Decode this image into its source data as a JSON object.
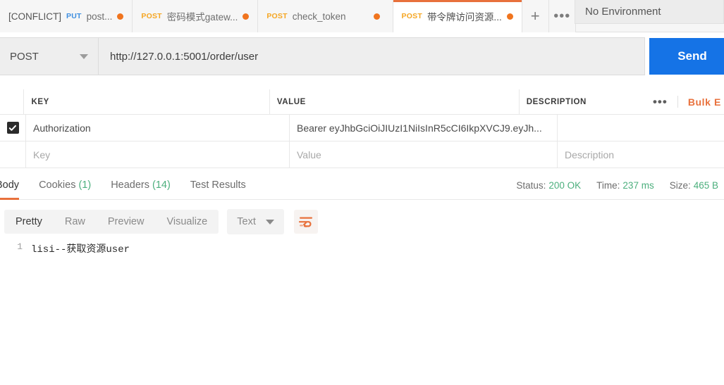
{
  "tabs": [
    {
      "prefix": "[CONFLICT]",
      "method": "PUT",
      "method_class": "put",
      "name": "post...",
      "unsaved": true,
      "active": false
    },
    {
      "prefix": "",
      "method": "POST",
      "method_class": "post",
      "name": "密码模式gatew...",
      "unsaved": true,
      "active": false
    },
    {
      "prefix": "",
      "method": "POST",
      "method_class": "post",
      "name": "check_token",
      "unsaved": true,
      "active": false
    },
    {
      "prefix": "",
      "method": "POST",
      "method_class": "post",
      "name": "带令牌访问资源...",
      "unsaved": true,
      "active": true
    }
  ],
  "tabbar": {
    "new_tab_glyph": "+",
    "more_glyph": "•••"
  },
  "environment": {
    "selected": "No Environment"
  },
  "request": {
    "method": "POST",
    "url": "http://127.0.0.1:5001/order/user",
    "send_label": "Send"
  },
  "headers_table": {
    "columns": [
      "KEY",
      "VALUE",
      "DESCRIPTION"
    ],
    "more_glyph": "•••",
    "bulk_edit_label": "Bulk E",
    "rows": [
      {
        "checked": true,
        "key": "Authorization",
        "value": "Bearer eyJhbGciOiJIUzI1NiIsInR5cCI6IkpXVCJ9.eyJh...",
        "description": ""
      }
    ],
    "placeholder_row": {
      "key": "Key",
      "value": "Value",
      "description": "Description"
    }
  },
  "response": {
    "tabs": [
      {
        "label": "Body",
        "count": "",
        "active": true
      },
      {
        "label": "Cookies",
        "count": "(1)",
        "active": false
      },
      {
        "label": "Headers",
        "count": "(14)",
        "active": false
      },
      {
        "label": "Test Results",
        "count": "",
        "active": false
      }
    ],
    "status_label": "Status:",
    "status_value": "200 OK",
    "time_label": "Time:",
    "time_value": "237 ms",
    "size_label": "Size:",
    "size_value": "465 B",
    "view_tabs": [
      {
        "label": "Pretty",
        "active": true
      },
      {
        "label": "Raw",
        "active": false
      },
      {
        "label": "Preview",
        "active": false
      },
      {
        "label": "Visualize",
        "active": false
      }
    ],
    "format": "Text",
    "body_lines": [
      {
        "no": "1",
        "text": "lisi--获取资源user"
      }
    ]
  },
  "colors": {
    "accent_orange": "#e8713c",
    "send_blue": "#1573e6",
    "status_green": "#4caf7d",
    "post_orange": "#f5a623",
    "put_blue": "#3f8fe0"
  }
}
